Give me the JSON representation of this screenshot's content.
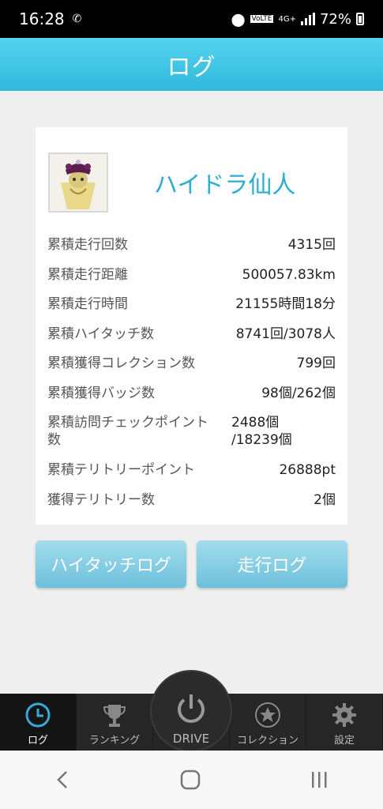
{
  "status_bar": {
    "time": "16:28",
    "network": "4G+",
    "volte": "VoLTE",
    "battery": "72%"
  },
  "header": {
    "title": "ログ"
  },
  "profile": {
    "name": "ハイドラ仙人"
  },
  "stats": [
    {
      "label": "累積走行回数",
      "value": "4315回"
    },
    {
      "label": "累積走行距離",
      "value": "500057.83km"
    },
    {
      "label": "累積走行時間",
      "value": "21155時間18分"
    },
    {
      "label": "累積ハイタッチ数",
      "value": "8741回/3078人"
    },
    {
      "label": "累積獲得コレクション数",
      "value": "799回"
    },
    {
      "label": "累積獲得バッジ数",
      "value": "98個/262個"
    },
    {
      "label": "累積訪問チェックポイント数",
      "value": "2488個\n/18239個"
    },
    {
      "label": "累積テリトリーポイント",
      "value": "26888pt"
    },
    {
      "label": "獲得テリトリー数",
      "value": "2個"
    }
  ],
  "buttons": {
    "hitouch_log": "ハイタッチログ",
    "driving_log": "走行ログ"
  },
  "tabs": {
    "log": "ログ",
    "ranking": "ランキング",
    "drive": "DRIVE",
    "collection": "コレクション",
    "settings": "設定"
  },
  "colors": {
    "accent": "#2fb9dc",
    "button": "#8fd0e6",
    "tabbar": "#262626"
  }
}
